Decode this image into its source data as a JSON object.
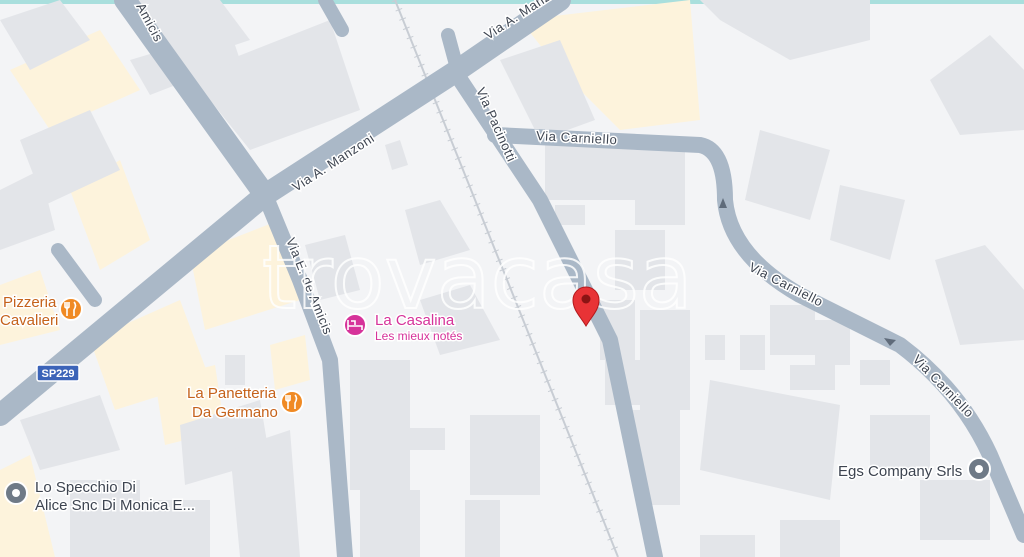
{
  "map": {
    "roads": {
      "manzoni_1": "Via A. Manzoni",
      "manzoni_2": "Via A. Manzoni",
      "amicis_top": "Amicis",
      "deamicis": "Via E. de Amicis",
      "pacinotti": "Via Pacinotti",
      "carniello_1": "Via Carniello",
      "carniello_2": "Via Carniello",
      "carniello_3": "Via Carniello"
    },
    "route_shield": "SP229",
    "pois": {
      "pizzeria_1": "Pizzeria",
      "pizzeria_2": "Cavalieri",
      "casalina": "La Casalina",
      "casalina_sub": "Les mieux notés",
      "panetteria_1": "La Panetteria",
      "panetteria_2": "Da Germano",
      "specchio_1": "Lo Specchio Di",
      "specchio_2": "Alice Snc Di Monica E...",
      "egs": "Egs Company Srls"
    },
    "watermark": "trovacasa",
    "icons": {
      "restaurant": "fork-knife-icon",
      "hotel": "bed-icon",
      "place": "place-pin-icon",
      "location": "location-pin-icon",
      "oneway": "one-way-arrow-icon"
    },
    "colors": {
      "road": "#aab8c7",
      "block": "#e3e5e9",
      "commercial": "#fdf3dc",
      "pin": "#e83336",
      "restaurant": "#f08a24",
      "hotel": "#d6339a",
      "background": "#f3f4f6"
    }
  }
}
